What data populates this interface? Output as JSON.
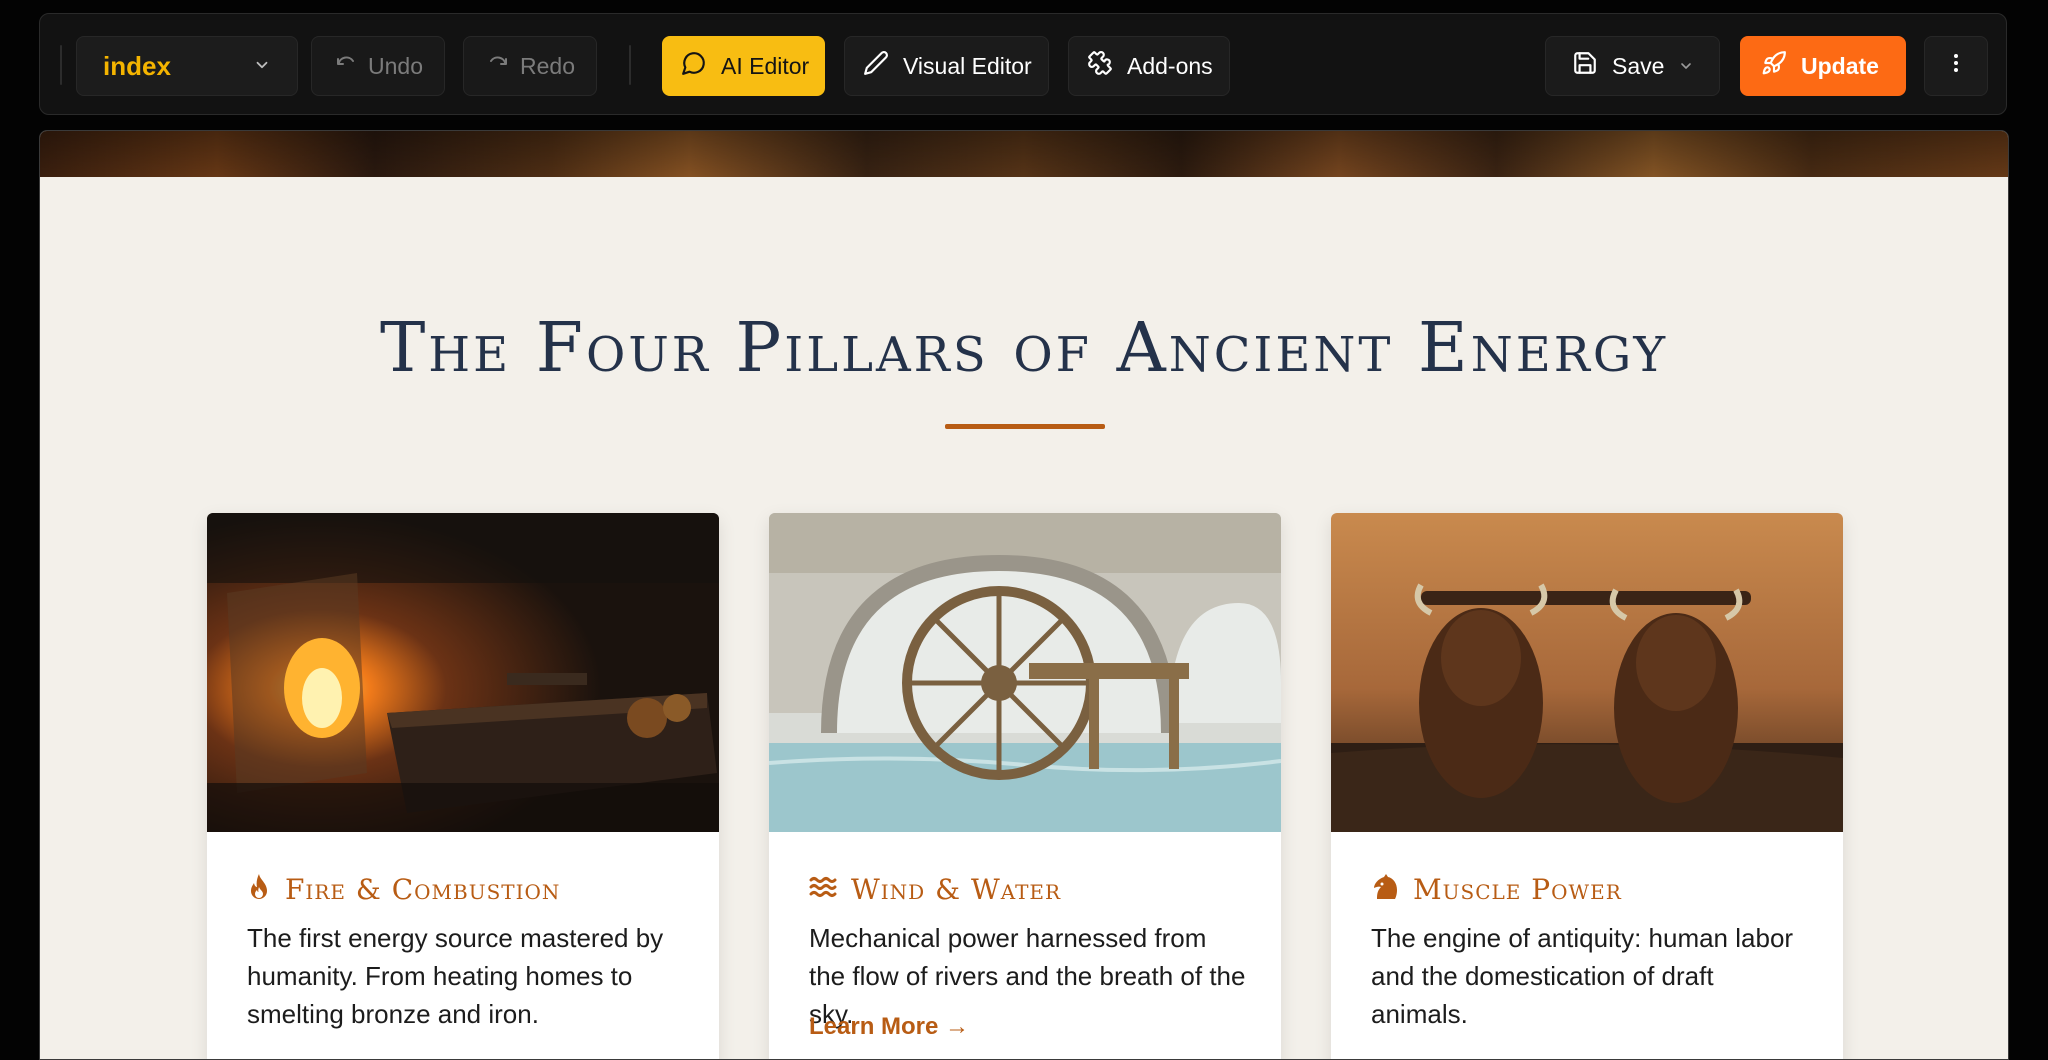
{
  "toolbar": {
    "page_select": {
      "label": "index",
      "icon": "chevron-down-icon"
    },
    "undo_label": "Undo",
    "redo_label": "Redo",
    "ai_editor_label": "AI Editor",
    "visual_editor_label": "Visual Editor",
    "addons_label": "Add-ons",
    "save_label": "Save",
    "update_label": "Update",
    "colors": {
      "accent_yellow": "#f8bd12",
      "accent_orange": "#fd6a14",
      "page_label": "#f4b400"
    }
  },
  "section": {
    "title": "The Four Pillars of Ancient Energy",
    "rule_color": "#b85c14"
  },
  "cards": [
    {
      "icon": "flame-icon",
      "title": "Fire & Combustion",
      "text": "The first energy source mastered by humanity. From heating homes to smelting bronze and iron."
    },
    {
      "icon": "waves-icon",
      "title": "Wind & Water",
      "text": "Mechanical power harnessed from the flow of rivers and the breath of the sky.",
      "link": "Learn More →"
    },
    {
      "icon": "horse-head-icon",
      "title": "Muscle Power",
      "text": "The engine of antiquity: human labor and the domestication of draft animals."
    }
  ]
}
